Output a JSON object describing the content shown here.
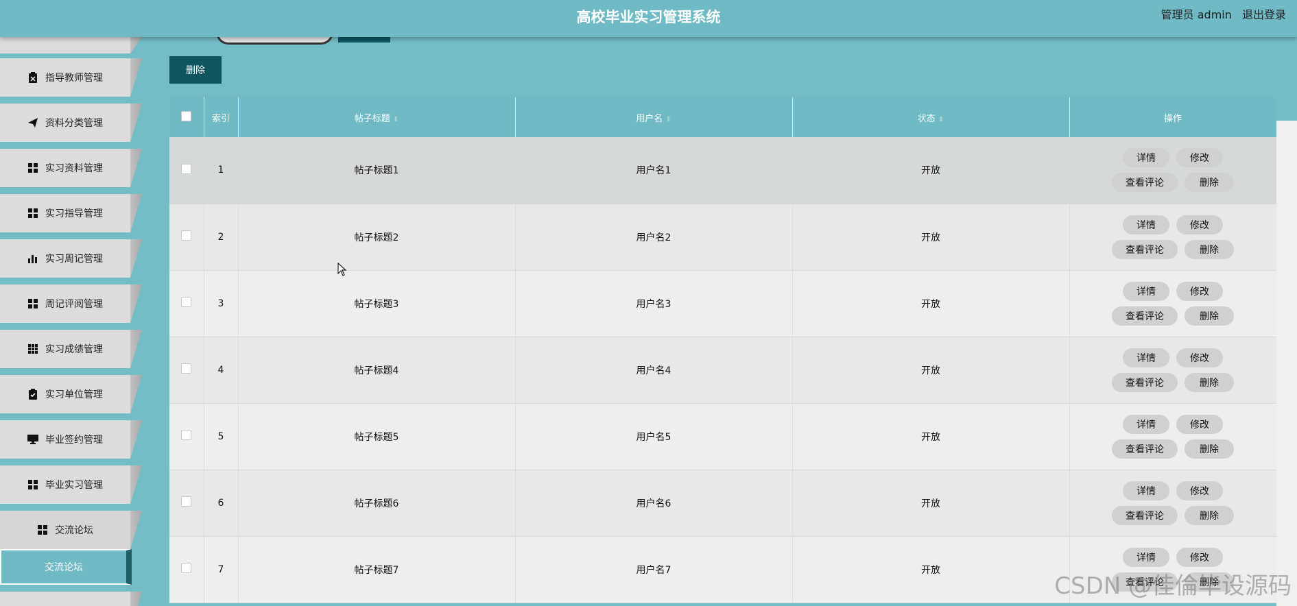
{
  "header": {
    "title": "高校毕业实习管理系统",
    "user": "管理员 admin",
    "logout": "退出登录"
  },
  "sidebar": {
    "items": [
      {
        "label": "指导教师管理",
        "icon": "clipboard-icon"
      },
      {
        "label": "资料分类管理",
        "icon": "send-icon"
      },
      {
        "label": "实习资料管理",
        "icon": "grid-icon"
      },
      {
        "label": "实习指导管理",
        "icon": "grid-icon"
      },
      {
        "label": "实习周记管理",
        "icon": "bar-chart-icon"
      },
      {
        "label": "周记评阅管理",
        "icon": "grid-icon"
      },
      {
        "label": "实习成绩管理",
        "icon": "grid-nine-icon"
      },
      {
        "label": "实习单位管理",
        "icon": "clipboard-check-icon"
      },
      {
        "label": "毕业签约管理",
        "icon": "monitor-icon"
      },
      {
        "label": "毕业实习管理",
        "icon": "grid-icon"
      },
      {
        "label": "交流论坛",
        "icon": "grid-icon"
      }
    ],
    "active_item": "交流论坛"
  },
  "toolbar": {
    "delete_label": "删除"
  },
  "table": {
    "columns": [
      "索引",
      "帖子标题",
      "用户名",
      "状态",
      "操作"
    ],
    "rows": [
      {
        "index": "1",
        "title": "帖子标题1",
        "username": "用户名1",
        "status": "开放"
      },
      {
        "index": "2",
        "title": "帖子标题2",
        "username": "用户名2",
        "status": "开放"
      },
      {
        "index": "3",
        "title": "帖子标题3",
        "username": "用户名3",
        "status": "开放"
      },
      {
        "index": "4",
        "title": "帖子标题4",
        "username": "用户名4",
        "status": "开放"
      },
      {
        "index": "5",
        "title": "帖子标题5",
        "username": "用户名5",
        "status": "开放"
      },
      {
        "index": "6",
        "title": "帖子标题6",
        "username": "用户名6",
        "status": "开放"
      },
      {
        "index": "7",
        "title": "帖子标题7",
        "username": "用户名7",
        "status": "开放"
      }
    ],
    "actions": {
      "detail": "详情",
      "edit": "修改",
      "view_comments": "查看评论",
      "delete": "删除"
    }
  },
  "watermark": "CSDN @佳倫毕设源码",
  "colors": {
    "header": "#6fbac4",
    "accent_dark": "#0f5560",
    "sidebar_item": "#dcdcdc"
  }
}
